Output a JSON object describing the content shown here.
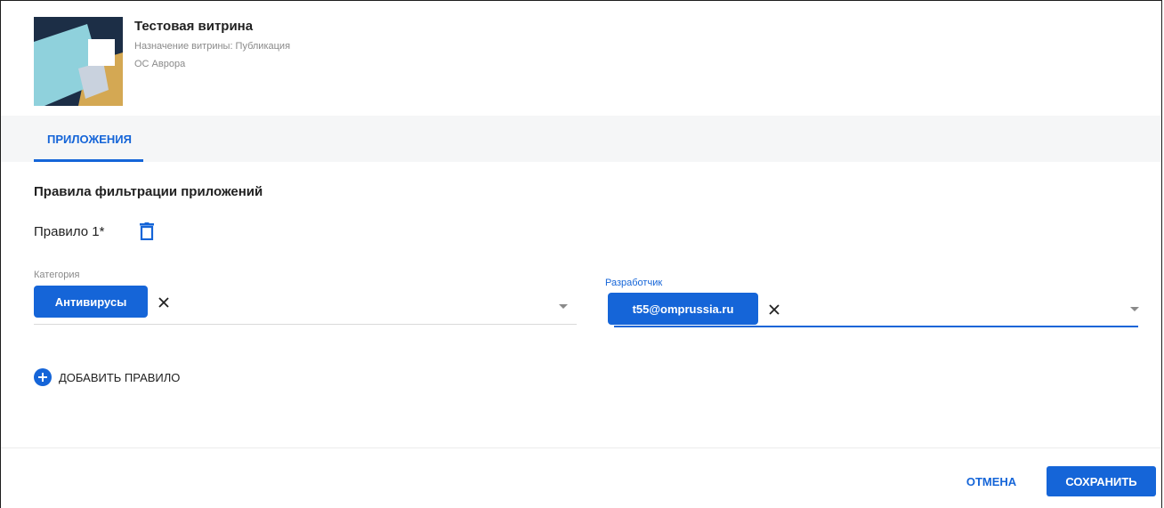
{
  "store": {
    "title": "Тестовая витрина",
    "purpose": "Назначение витрины: Публикация",
    "os": "ОС Аврора"
  },
  "tabs": [
    {
      "label": "ПРИЛОЖЕНИЯ",
      "active": true
    }
  ],
  "filters": {
    "section_title": "Правила фильтрации приложений",
    "rules": [
      {
        "label": "Правило 1*",
        "category": {
          "label": "Категория",
          "chips": [
            "Антивирусы"
          ]
        },
        "developer": {
          "label": "Разработчик",
          "chips": [
            "t55@omprussia.ru"
          ],
          "focused": true
        }
      }
    ],
    "add_rule_label": "ДОБАВИТЬ ПРАВИЛО"
  },
  "actions": {
    "cancel_label": "ОТМЕНА",
    "save_label": "СОХРАНИТЬ"
  },
  "icons": {
    "delete": "trash-icon",
    "remove_chip": "close-icon",
    "dropdown": "chevron-down-icon",
    "add": "add-circle-icon"
  },
  "colors": {
    "accent": "#1565d8",
    "tabs_bg": "#f5f6f7",
    "muted_text": "#8a8a8a"
  }
}
